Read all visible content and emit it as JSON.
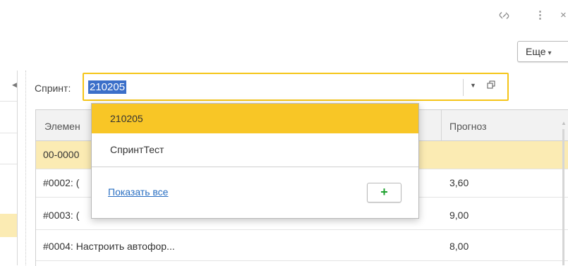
{
  "window": {
    "link_icon": "link-icon",
    "more_icon": "vertical-dots-icon",
    "close_icon": "close-icon"
  },
  "toolbar": {
    "more_label": "Еще"
  },
  "filter": {
    "label": "Спринт:",
    "value": "210205"
  },
  "table": {
    "columns": [
      "Элемен",
      "Прогноз"
    ],
    "rows": [
      {
        "element": "00-0000",
        "forecast": ""
      },
      {
        "element": "#0002: (",
        "forecast": "3,60"
      },
      {
        "element": "#0003: (",
        "forecast": "9,00"
      },
      {
        "element": "#0004: Настроить автофор...",
        "forecast": "8,00"
      }
    ]
  },
  "dropdown": {
    "items": [
      "210205",
      "СпринтТест"
    ],
    "show_all": "Показать все",
    "add_label": "+"
  },
  "colors": {
    "accent": "#f5c518",
    "selection": "#fbebb3",
    "link": "#2a6fc2",
    "add": "#1fa22f",
    "text_selection": "#3b6fc9"
  }
}
